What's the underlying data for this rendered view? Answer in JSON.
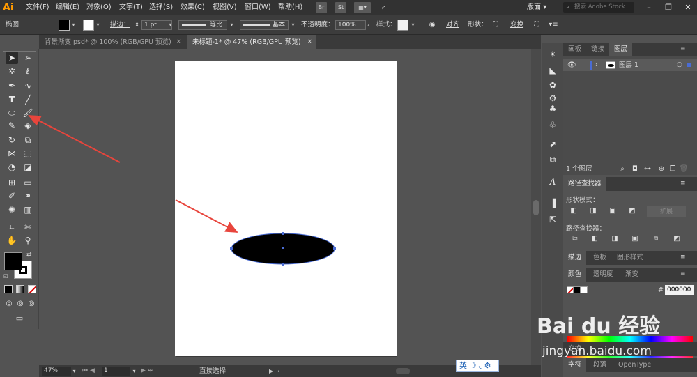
{
  "app": {
    "logo": "Ai",
    "workspace": "版面",
    "stock_search_placeholder": "搜索 Adobe Stock",
    "bridge_label": "Br",
    "stock_label": "St"
  },
  "menu": [
    "文件(F)",
    "编辑(E)",
    "对象(O)",
    "文字(T)",
    "选择(S)",
    "效果(C)",
    "视图(V)",
    "窗口(W)",
    "帮助(H)"
  ],
  "control_bar": {
    "selection_name": "椭圆",
    "stroke_label": "描边：",
    "stroke_weight": "1 pt",
    "stroke_profile": "等比",
    "brush": "基本",
    "opacity_label": "不透明度：",
    "opacity_value": "100%",
    "style_label": "样式：",
    "align_label": "对齐",
    "shape_label": "形状：",
    "transform_label": "变换"
  },
  "tabs": [
    {
      "label": "背景渐变.psd* @ 100% (RGB/GPU 预览)",
      "active": false
    },
    {
      "label": "未标题-1* @ 47% (RGB/GPU 预览)",
      "active": true
    }
  ],
  "status_bar": {
    "zoom": "47%",
    "artboard_number": "1",
    "tool_text": "直接选择"
  },
  "ime": {
    "lang": "英"
  },
  "layers_panel": {
    "tabs": [
      "画板",
      "链接",
      "图层"
    ],
    "active_tab": "图层",
    "layers": [
      {
        "name": "图层 1"
      }
    ],
    "count_text": "1 个图层"
  },
  "pathfinder_panel": {
    "title": "路径查找器",
    "shape_modes_label": "形状模式：",
    "expand_label": "扩展",
    "pathfinders_label": "路径查找器："
  },
  "stroke_panel": {
    "tabs": [
      "描边",
      "色板",
      "图形样式"
    ]
  },
  "color_panel": {
    "tabs": [
      "颜色",
      "透明度",
      "渐变"
    ],
    "hex_label": "#",
    "hex_value": "000000"
  },
  "bottom_panels": {
    "transform_tab": "变换",
    "char_tabs": [
      "字符",
      "段落",
      "OpenType"
    ]
  },
  "watermark": {
    "logo": "Bai du 经验",
    "url": "jingyan.baidu.com"
  },
  "colors": {
    "fill": "#000000",
    "accent_orange": "#ff9a00",
    "annotation_arrow": "#e8453c",
    "selection_blue": "#4a6cd4"
  }
}
